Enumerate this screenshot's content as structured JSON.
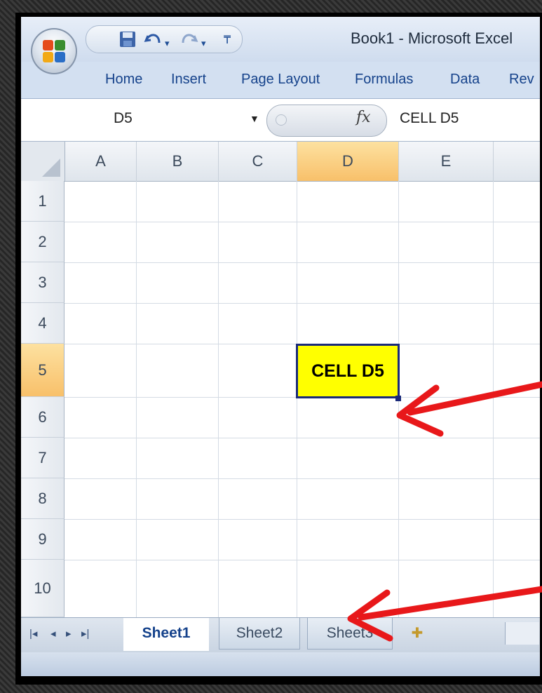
{
  "window": {
    "title": "Book1 - Microsoft Excel"
  },
  "ribbon": {
    "tabs": [
      "Home",
      "Insert",
      "Page Layout",
      "Formulas",
      "Data",
      "Rev"
    ]
  },
  "formula_bar": {
    "name_box": "D5",
    "fx_symbol": "fx",
    "content": "CELL D5"
  },
  "grid": {
    "columns": [
      "A",
      "B",
      "C",
      "D",
      "E"
    ],
    "rows": [
      "1",
      "2",
      "3",
      "4",
      "5",
      "6",
      "7",
      "8",
      "9",
      "10"
    ],
    "selected_column": "D",
    "selected_row": "5",
    "active_cell": {
      "ref": "D5",
      "value": "CELL D5",
      "fill_color": "#ffff00",
      "border_color": "#1a2a7a"
    }
  },
  "sheets": {
    "tabs": [
      "Sheet1",
      "Sheet2",
      "Sheet3"
    ],
    "active": "Sheet1"
  },
  "icons": {
    "office_button": "office-logo-icon",
    "save": "save-icon",
    "undo": "undo-icon",
    "redo": "redo-icon",
    "customize": "customize-qat-icon",
    "fx": "function-icon",
    "new_sheet": "insert-sheet-icon"
  },
  "annotation": {
    "arrow_color": "#e8181a"
  }
}
